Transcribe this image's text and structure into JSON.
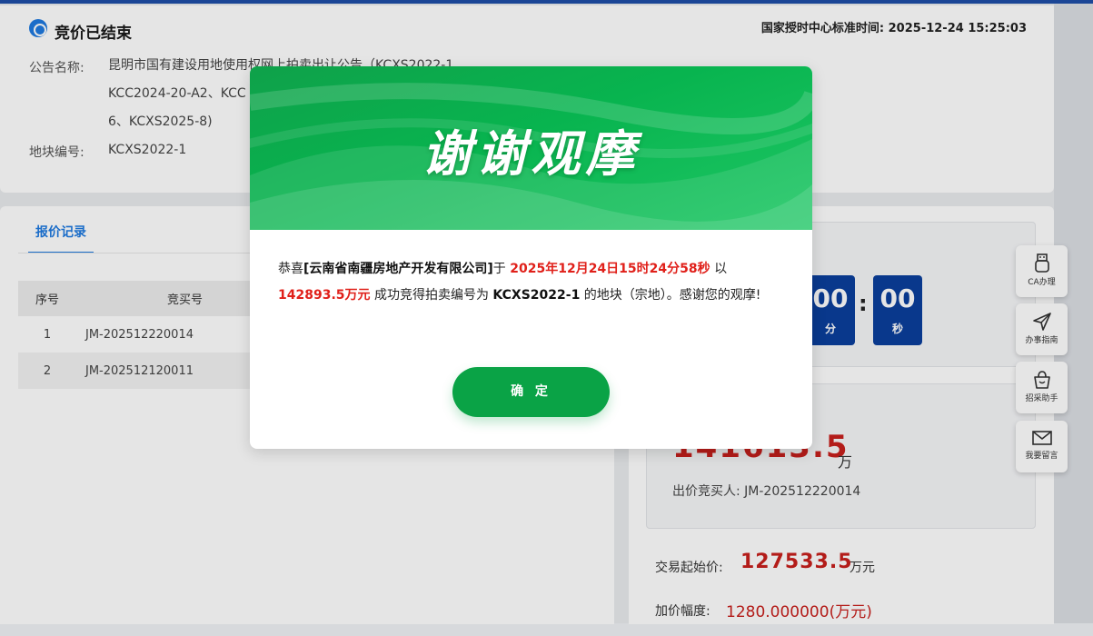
{
  "header": {
    "status_title": "竞价已结束",
    "server_time_label": "国家授时中心标准时间:",
    "server_time": "2025-12-24 15:25:03",
    "announcement_label": "公告名称:",
    "announcement_line1": "昆明市国有建设用地使用权网上拍卖出让公告（KCXS2022-1、",
    "announcement_line2": "KCC2024-20-A2、KCC",
    "announcement_line3": "6、KCXS2025-8)",
    "plot_label": "地块编号:",
    "plot_value": "KCXS2022-1"
  },
  "record": {
    "tab_label": "报价记录",
    "columns": {
      "index": "序号",
      "bidder_no": "竞买号"
    },
    "rows": [
      {
        "index": "1",
        "bidder_no": "JM-202512220014"
      },
      {
        "index": "2",
        "bidder_no": "JM-202512120011"
      }
    ]
  },
  "countdown": {
    "minutes": "00",
    "minutes_label": "分",
    "seconds": "00",
    "seconds_label": "秒",
    "separator": ":"
  },
  "price": {
    "current_price": "141613.5",
    "current_unit": "万",
    "bidder_label": "出价竞买人:",
    "bidder": "JM-202512220014",
    "start_label": "交易起始价:",
    "start_value": "127533.5",
    "start_unit": "万元",
    "increment_label": "加价幅度:",
    "increment_value": "1280.000000(万元)"
  },
  "side_buttons": [
    {
      "label": "CA办理",
      "icon": "usb-key-icon"
    },
    {
      "label": "办事指南",
      "icon": "send-icon"
    },
    {
      "label": "招采助手",
      "icon": "basket-icon"
    },
    {
      "label": "我要留言",
      "icon": "mail-icon"
    }
  ],
  "modal": {
    "banner_title": "谢谢观摩",
    "text_prefix": "恭喜",
    "company": "[云南省南疆房地产开发有限公司]",
    "text_at": "于 ",
    "win_time": "2025年12月24日15时24分58秒",
    "text_with": " 以",
    "win_price": "142893.5万元",
    "text_win": " 成功竞得拍卖编号为 ",
    "lot_no": "KCXS2022-1",
    "text_suffix": " 的地块（宗地）。感谢您的观摩!",
    "confirm_label": "确 定"
  },
  "colors": {
    "accent_blue": "#1f7ae0",
    "countdown_blue": "#0b3f9c",
    "price_red": "#c8201c",
    "modal_green": "#0aa346"
  }
}
